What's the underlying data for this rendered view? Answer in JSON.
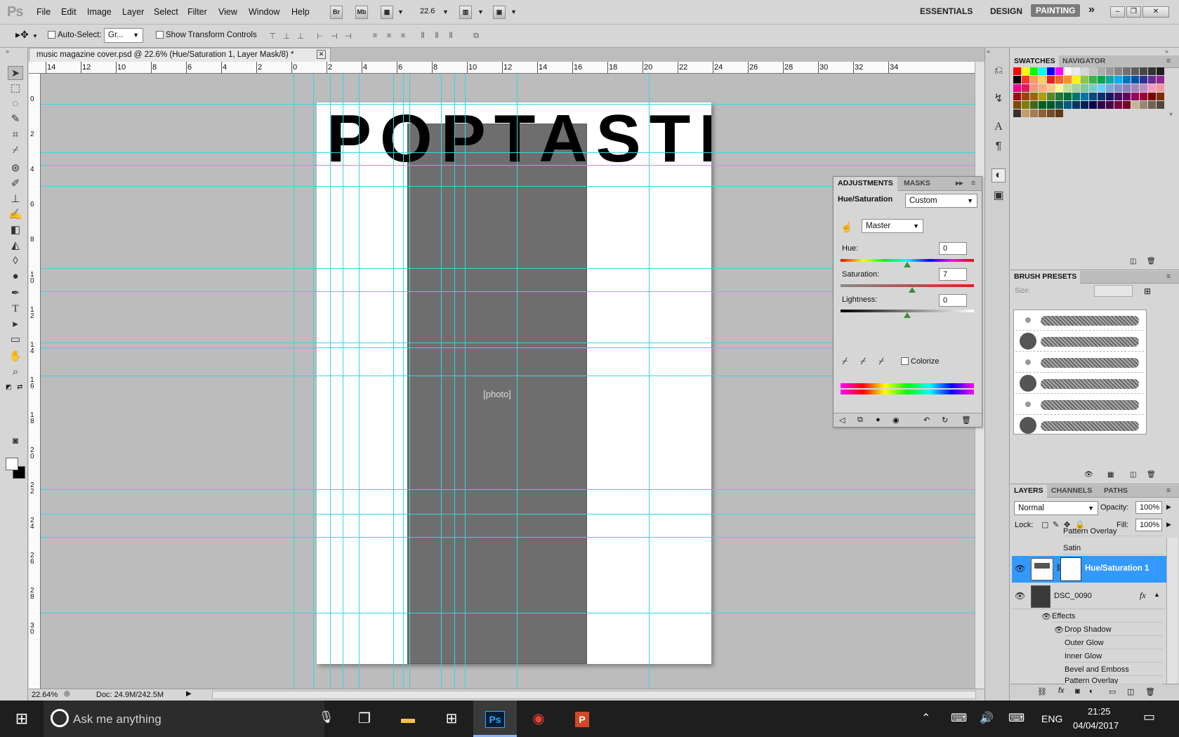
{
  "menubar": {
    "logo": "Ps",
    "items": [
      "File",
      "Edit",
      "Image",
      "Layer",
      "Select",
      "Filter",
      "View",
      "Window",
      "Help"
    ],
    "br_label": "Br",
    "mb_label": "Mb",
    "zoom": "22.6",
    "workspaces": [
      "ESSENTIALS",
      "DESIGN",
      "PAINTING"
    ],
    "more": "»"
  },
  "options": {
    "auto_select_label": "Auto-Select:",
    "auto_select_value": "Gr...",
    "show_transform_label": "Show Transform Controls"
  },
  "document": {
    "tab_title": "music magazine cover.psd @ 22.6% (Hue/Saturation 1, Layer Mask/8) *",
    "cover_title": "POPTASTIC",
    "photo_alt": "[photo]",
    "zoom_status": "22.64%",
    "doc_status": "Doc: 24.9M/242.5M",
    "h_ruler": [
      "14",
      "12",
      "10",
      "8",
      "6",
      "4",
      "2",
      "0",
      "2",
      "4",
      "6",
      "8",
      "10",
      "12",
      "14",
      "16",
      "18",
      "20",
      "22",
      "24",
      "26",
      "28",
      "30",
      "32",
      "34"
    ],
    "v_ruler": [
      "0",
      "2",
      "4",
      "6",
      "8",
      "1 0",
      "1 2",
      "1 4",
      "1 6",
      "1 8",
      "2 0",
      "2 2",
      "2 4",
      "2 6",
      "2 8",
      "3 0"
    ]
  },
  "adjustments": {
    "tabs": [
      "ADJUSTMENTS",
      "MASKS"
    ],
    "title": "Hue/Saturation",
    "preset": "Custom",
    "channel": "Master",
    "hue_label": "Hue:",
    "hue": "0",
    "sat_label": "Saturation:",
    "sat": "7",
    "light_label": "Lightness:",
    "light": "0",
    "colorize": "Colorize",
    "hue_level": 0,
    "sat_level": 7,
    "light_level": 0
  },
  "swatches": {
    "tabs": [
      "SWATCHES",
      "NAVIGATOR"
    ]
  },
  "brushes": {
    "title": "BRUSH PRESETS",
    "size_label": "Size:"
  },
  "layers": {
    "tabs": [
      "LAYERS",
      "CHANNELS",
      "PATHS"
    ],
    "blend_mode": "Normal",
    "opacity_label": "Opacity:",
    "opacity": "100%",
    "lock_label": "Lock:",
    "fill_label": "Fill:",
    "fill": "100%",
    "rows": [
      "Pattern Overlay",
      "Satin",
      "Hue/Saturation 1",
      "DSC_0090",
      "Effects",
      "Drop Shadow",
      "Outer Glow",
      "Inner Glow",
      "Bevel and Emboss",
      "Pattern Overlay"
    ],
    "fx": "fx"
  },
  "taskbar": {
    "search": "Ask me anything",
    "lang": "ENG",
    "time": "21:25",
    "date": "04/04/2017"
  }
}
